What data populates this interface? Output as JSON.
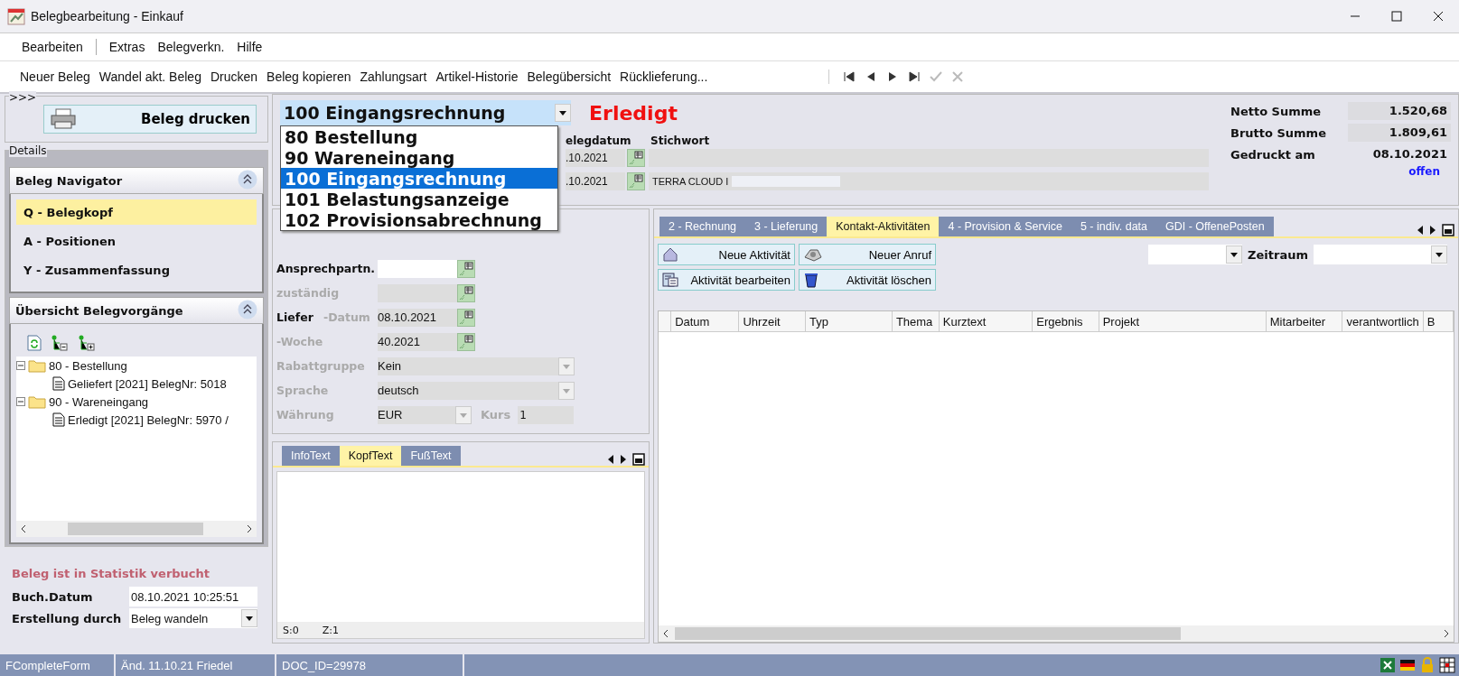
{
  "window": {
    "title": "Belegbearbeitung - Einkauf"
  },
  "menu": [
    {
      "label": "Bearbeiten"
    },
    {
      "label": "Extras"
    },
    {
      "label": "Belegverkn."
    },
    {
      "label": "Hilfe"
    }
  ],
  "toolbar": [
    {
      "label": "Neuer Beleg"
    },
    {
      "label": "Wandel akt. Beleg"
    },
    {
      "label": "Drucken"
    },
    {
      "label": "Beleg kopieren"
    },
    {
      "label": "Zahlungsart"
    },
    {
      "label": "Artikel-Historie"
    },
    {
      "label": "Belegübersicht"
    },
    {
      "label": "Rücklieferung..."
    }
  ],
  "record_nav": [
    {
      "kind": "first",
      "disabled": false
    },
    {
      "kind": "prev",
      "disabled": false
    },
    {
      "kind": "next",
      "disabled": false
    },
    {
      "kind": "last",
      "disabled": false
    },
    {
      "kind": "confirm",
      "disabled": true
    },
    {
      "kind": "cancel",
      "disabled": true
    }
  ],
  "left_panel": {
    "group_label": ">>>",
    "print_button": "Beleg drucken",
    "details_label": "Details",
    "navigator": {
      "title": "Beleg Navigator",
      "expanded": true,
      "items": [
        {
          "label": "Q - Belegkopf",
          "selected": true
        },
        {
          "label": "A - Positionen",
          "selected": false
        },
        {
          "label": "Y - Zusammenfassung",
          "selected": false
        }
      ]
    },
    "overview": {
      "title": "Übersicht Belegvorgänge",
      "expanded": true,
      "tree": [
        {
          "label": "80 - Bestellung",
          "expanded": true,
          "children": [
            {
              "label": "Geliefert [2021] BelegNr: 5018"
            }
          ]
        },
        {
          "label": "90 - Wareneingang",
          "expanded": true,
          "children": [
            {
              "label": "Erledigt [2021] BelegNr: 5970 /"
            }
          ]
        }
      ]
    },
    "statistics_note": "Beleg ist in Statistik verbucht",
    "booking_date": {
      "label": "Buch.Datum",
      "value": "08.10.2021 10:25:51"
    },
    "created_by": {
      "label": "Erstellung durch",
      "value": "Beleg wandeln"
    }
  },
  "header": {
    "doc_type": {
      "value": "100 Eingangsrechnung",
      "open": true,
      "options": [
        {
          "label": "80 Bestellung",
          "selected": false
        },
        {
          "label": "90 Wareneingang",
          "selected": false
        },
        {
          "label": "100 Eingangsrechnung",
          "selected": true
        },
        {
          "label": "101 Belastungsanzeige",
          "selected": false
        },
        {
          "label": "102 Provisionsabrechnung",
          "selected": false
        }
      ]
    },
    "status": "Erledigt",
    "date_label": "elegdatum",
    "dates": [
      ".10.2021",
      ".10.2021"
    ],
    "keyword_label": "Stichwort",
    "keywords": [
      {
        "blurred": false
      },
      {
        "value": "TERRA CLOUD I",
        "blurred": true
      }
    ],
    "totals": [
      {
        "label": "Netto Summe",
        "value": "1.520,68",
        "boxed": true
      },
      {
        "label": "Brutto Summe",
        "value": "1.809,61",
        "boxed": true
      },
      {
        "label": "Gedruckt am",
        "value": "08.10.2021",
        "boxed": false
      }
    ],
    "print_status": "offen"
  },
  "form": {
    "fields": [
      {
        "kind": "picker",
        "label": "Ansprechpartn.",
        "disabled": false
      },
      {
        "kind": "picker",
        "label": "zuständig",
        "disabled": true
      },
      {
        "kind": "picker",
        "group": "Liefer",
        "label": "-Datum",
        "value": "08.10.2021",
        "disabled": true
      },
      {
        "kind": "picker",
        "label": "-Woche",
        "value": "40.2021",
        "disabled": true
      },
      {
        "kind": "select",
        "label": "Rabattgruppe",
        "value": "Kein",
        "disabled": true
      },
      {
        "kind": "select",
        "label": "Sprache",
        "value": "deutsch",
        "disabled": true
      },
      {
        "kind": "currency",
        "label": "Währung",
        "value": "EUR",
        "rate_label": "Kurs",
        "rate": "1",
        "disabled": true
      }
    ]
  },
  "text_tabs": {
    "tabs": [
      {
        "label": "InfoText",
        "selected": false
      },
      {
        "label": "KopfText",
        "selected": true
      },
      {
        "label": "FußText",
        "selected": false
      }
    ],
    "status": [
      "S:0",
      "Z:1"
    ]
  },
  "detail_tabs": [
    {
      "label": "2 - Rechnung",
      "selected": false
    },
    {
      "label": "3 - Lieferung",
      "selected": false
    },
    {
      "label": "Kontakt-Aktivitäten",
      "selected": true
    },
    {
      "label": "4 - Provision & Service",
      "selected": false
    },
    {
      "label": "5 - indiv. data",
      "selected": false
    },
    {
      "label": "GDI - OffenePosten",
      "selected": false
    }
  ],
  "activity_buttons": [
    {
      "kind": "new",
      "label": "Neue Aktivität"
    },
    {
      "kind": "call",
      "label": "Neuer Anruf"
    },
    {
      "kind": "edit",
      "label": "Aktivität bearbeiten"
    },
    {
      "kind": "delete",
      "label": "Aktivität löschen"
    }
  ],
  "period_label": "Zeitraum",
  "table": {
    "columns": [
      "Datum",
      "Uhrzeit",
      "Typ",
      "Thema",
      "Kurztext",
      "Ergebnis",
      "Projekt",
      "Mitarbeiter",
      "verantwortlich",
      "B"
    ]
  },
  "status_bar": [
    "FCompleteForm",
    "Änd. 11.10.21 Friedel",
    "DOC_ID=29978"
  ]
}
